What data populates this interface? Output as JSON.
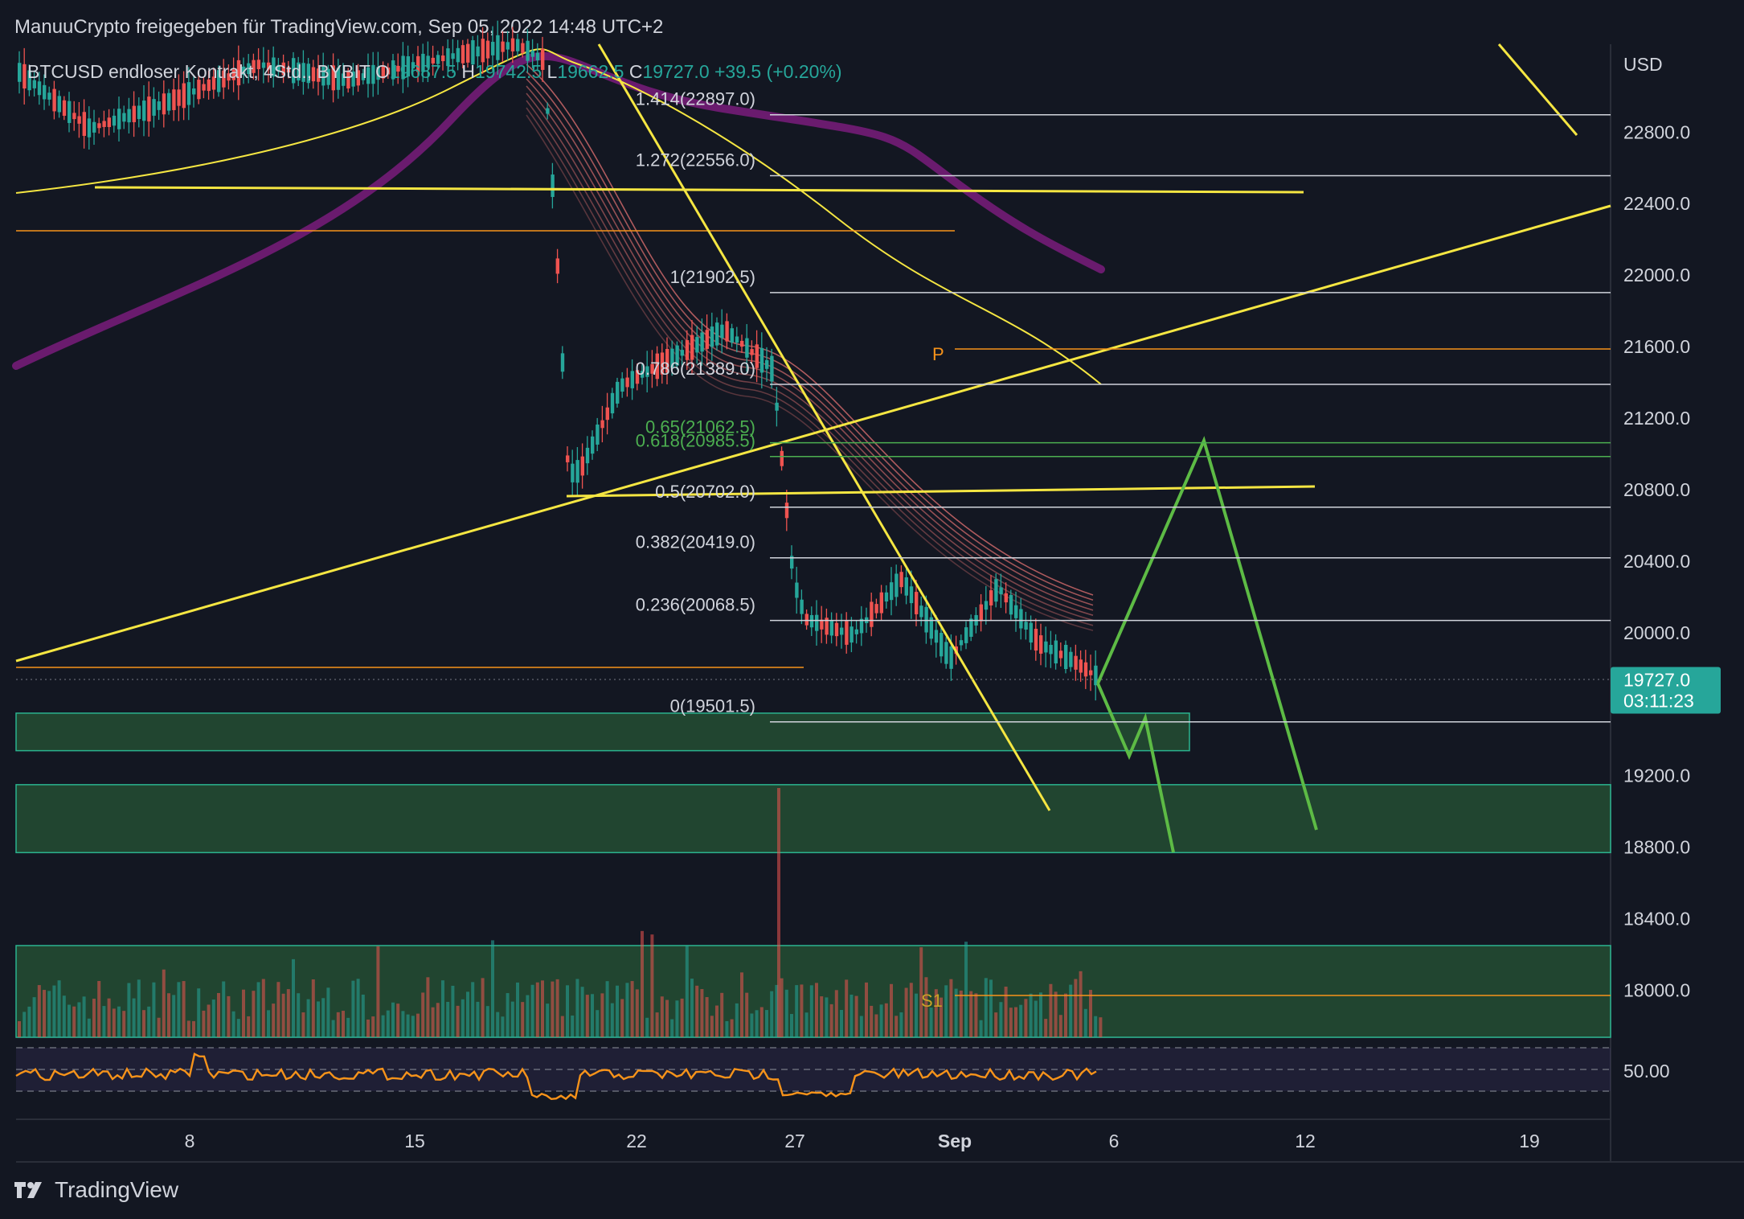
{
  "header": {
    "publisher": "ManuuCrypto freigegeben für TradingView.com, Sep 05, 2022 14:48 UTC+2",
    "symbol": "BTCUSD endloser Kontrakt, 4Std., BYBIT",
    "o_label": "O",
    "o": "19687.5",
    "h_label": "H",
    "h": "19742.5",
    "l_label": "L",
    "l": "19662.5",
    "c_label": "C",
    "c": "19727.0",
    "change": "+39.5 (+0.20%)"
  },
  "branding": {
    "logo_text": "TradingView",
    "logo_icon": "tradingview-logo-icon"
  },
  "colors": {
    "background": "#131722",
    "up": "#26a69a",
    "down": "#ef5350",
    "yellow": "#f5e642",
    "orange": "#f7931a",
    "green_path": "#5dbb45",
    "zone": "#2e6b3c",
    "ma_purple": "#6a1b6e",
    "price_tag": "#26a69a",
    "rsi": "#f7931a"
  },
  "chart_data": {
    "type": "candlestick",
    "currency": "USD",
    "y_axis_ticks": [
      22800,
      22400,
      22000,
      21600,
      21200,
      20800,
      20400,
      20000,
      19200,
      18800,
      18400,
      18000
    ],
    "x_axis_ticks": [
      "8",
      "15",
      "22",
      "27",
      "Sep",
      "6",
      "12",
      "19"
    ],
    "ylim": [
      17750,
      23300
    ],
    "last_price": {
      "price": "19727.0",
      "countdown": "03:11:23",
      "value": 19727.0
    },
    "fib_levels": [
      {
        "label": "1.414(22897.0)",
        "price": 22897.0
      },
      {
        "label": "1.272(22556.0)",
        "price": 22556.0
      },
      {
        "label": "1(21902.5)",
        "price": 21902.5
      },
      {
        "label": "0.786(21389.0)",
        "price": 21389.0
      },
      {
        "label": "0.65(21062.5)",
        "price": 21062.5
      },
      {
        "label": "0.618(20985.5)",
        "price": 20985.5
      },
      {
        "label": "0.5(20702.0)",
        "price": 20702.0
      },
      {
        "label": "0.382(20419.0)",
        "price": 20419.0
      },
      {
        "label": "0.236(20068.5)",
        "price": 20068.5
      },
      {
        "label": "0(19501.5)",
        "price": 19501.5
      }
    ],
    "pivots": [
      {
        "label": "P",
        "price": 21600
      },
      {
        "label": "S1",
        "price": 17960
      }
    ],
    "zones": [
      {
        "top": 19550,
        "bottom": 19340
      },
      {
        "top": 19150,
        "bottom": 18770
      },
      {
        "top": 18250,
        "bottom": 17750
      }
    ],
    "rsi": {
      "value_label": "50.00",
      "value": 50
    }
  }
}
